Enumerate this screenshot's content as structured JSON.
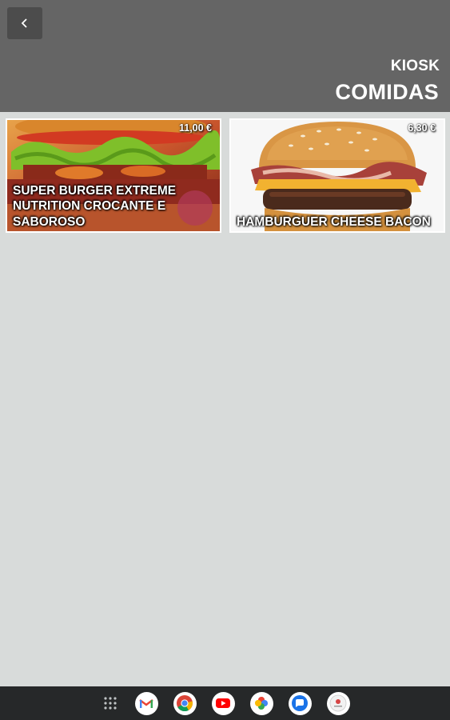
{
  "header": {
    "back_label": "Back",
    "subtitle": "KIOSK",
    "title": "COMIDAS"
  },
  "products": [
    {
      "name": "SUPER BURGER EXTREME NUTRITION CROCANTE E SABOROSO",
      "price": "11,00 €"
    },
    {
      "name": "HAMBURGUER CHEESE BACON",
      "price": "6,30 €"
    }
  ],
  "taskbar": {
    "apps": [
      "app-launcher-icon",
      "gmail-icon",
      "chrome-icon",
      "youtube-icon",
      "photos-icon",
      "messages-icon",
      "kiosk-app-icon"
    ]
  },
  "colors": {
    "header_bg": "#656565",
    "page_bg": "#d8dbda",
    "taskbar_bg": "#262829"
  }
}
